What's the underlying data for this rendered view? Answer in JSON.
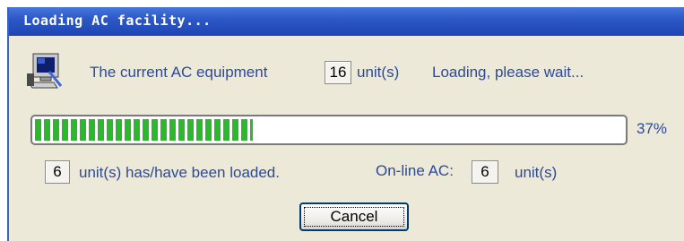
{
  "window": {
    "title": "Loading AC facility..."
  },
  "status_line": {
    "icon": "computer-monitor-icon",
    "prefix": "The current AC equipment",
    "equipment_count": "16",
    "suffix": "unit(s)",
    "message": "Loading, please wait..."
  },
  "progress": {
    "value": 0.37,
    "percent_label": "37%",
    "fill_color": "#2fb62f"
  },
  "loaded_line": {
    "loaded_count": "6",
    "loaded_text": "unit(s) has/have been loaded.",
    "online_label": "On-line AC:",
    "online_count": "6",
    "online_unit": "unit(s)"
  },
  "buttons": {
    "cancel_label": "Cancel"
  }
}
